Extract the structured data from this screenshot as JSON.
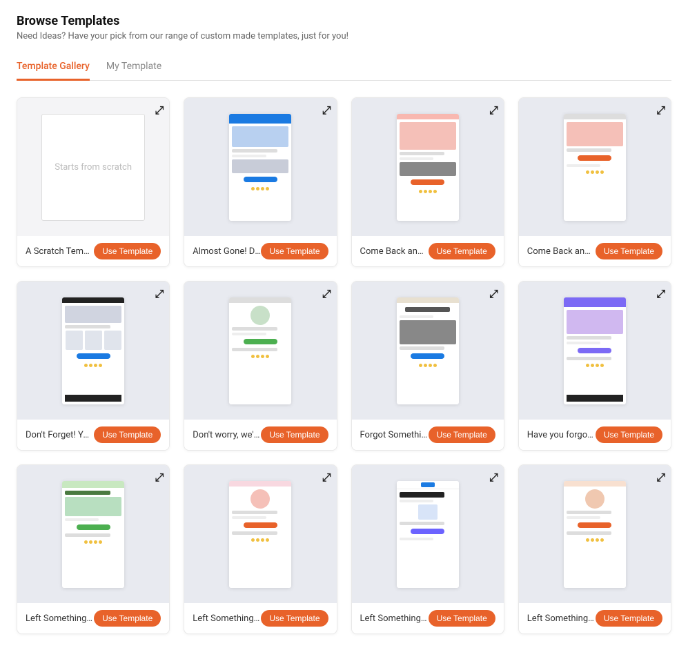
{
  "page": {
    "title": "Browse Templates",
    "subtitle": "Need Ideas? Have your pick from our range of custom made templates, just for you!"
  },
  "tabs": [
    {
      "id": "gallery",
      "label": "Template Gallery",
      "active": true
    },
    {
      "id": "my",
      "label": "My Template",
      "active": false
    }
  ],
  "use_button_label": "Use Template",
  "expand_icon": "⤢",
  "scratch_label": "Starts from scratch",
  "templates": [
    {
      "id": 1,
      "name": "A Scratch Template",
      "style": "scratch"
    },
    {
      "id": 2,
      "name": "Almost Gone! Don't ...",
      "style": "blue-header"
    },
    {
      "id": 3,
      "name": "Come Back and Sav...",
      "style": "pink-fashion"
    },
    {
      "id": 4,
      "name": "Come Back and Sav...",
      "style": "product-pink"
    },
    {
      "id": 5,
      "name": "Don't Forget! Your It...",
      "style": "cart-reminder"
    },
    {
      "id": 6,
      "name": "Don't worry, we've g...",
      "style": "green-promo"
    },
    {
      "id": 7,
      "name": "Forgot Something?",
      "style": "forgot"
    },
    {
      "id": 8,
      "name": "Have you forgotten ...",
      "style": "purple-banner"
    },
    {
      "id": 9,
      "name": "Left Something Behi...",
      "style": "green-light"
    },
    {
      "id": 10,
      "name": "Left Something Behi...",
      "style": "pink-circle"
    },
    {
      "id": 11,
      "name": "Left Something Behi...",
      "style": "acme-blue"
    },
    {
      "id": 12,
      "name": "Left Something Behi...",
      "style": "peach-circle"
    }
  ]
}
